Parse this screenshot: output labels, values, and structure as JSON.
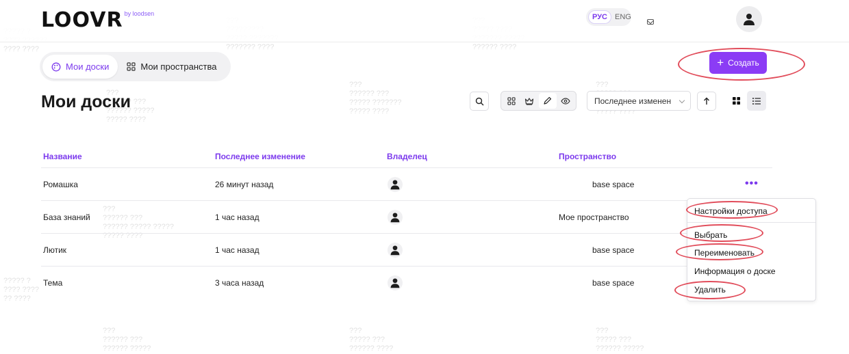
{
  "brand": {
    "logo": "LOOVR",
    "by": "by loodsen"
  },
  "header": {
    "lang_active": "РУС",
    "lang_other": "ENG"
  },
  "tabs": [
    {
      "label": "Мои доски"
    },
    {
      "label": "Мои пространства"
    }
  ],
  "create_label": "Создать",
  "page_title": "Мои доски",
  "sort": {
    "selected": "Последнее изменение"
  },
  "table": {
    "columns": [
      "Название",
      "Последнее изменение",
      "Владелец",
      "Пространство"
    ],
    "rows": [
      {
        "name": "Ромашка",
        "modified": "26 минут назад",
        "space": "base space"
      },
      {
        "name": "База знаний",
        "modified": "1 час назад",
        "space": "Мое пространство"
      },
      {
        "name": "Лютик",
        "modified": "1 час назад",
        "space": "base space"
      },
      {
        "name": "Тема",
        "modified": "3 часа назад",
        "space": "base space"
      }
    ]
  },
  "context_menu": [
    "Настройки доступа",
    "Выбрать",
    "Переименовать",
    "Информация о доске",
    "Удалить"
  ],
  "colors": {
    "accent": "#8b3cf5",
    "annotation": "#e14c5a"
  },
  "icons": [
    "user-icon",
    "mail-icon",
    "palette-icon",
    "grid-icon",
    "search-icon",
    "crown-icon",
    "pencil-icon",
    "eye-icon",
    "arrow-up-icon",
    "tiles-icon",
    "list-icon",
    "more-icon"
  ]
}
